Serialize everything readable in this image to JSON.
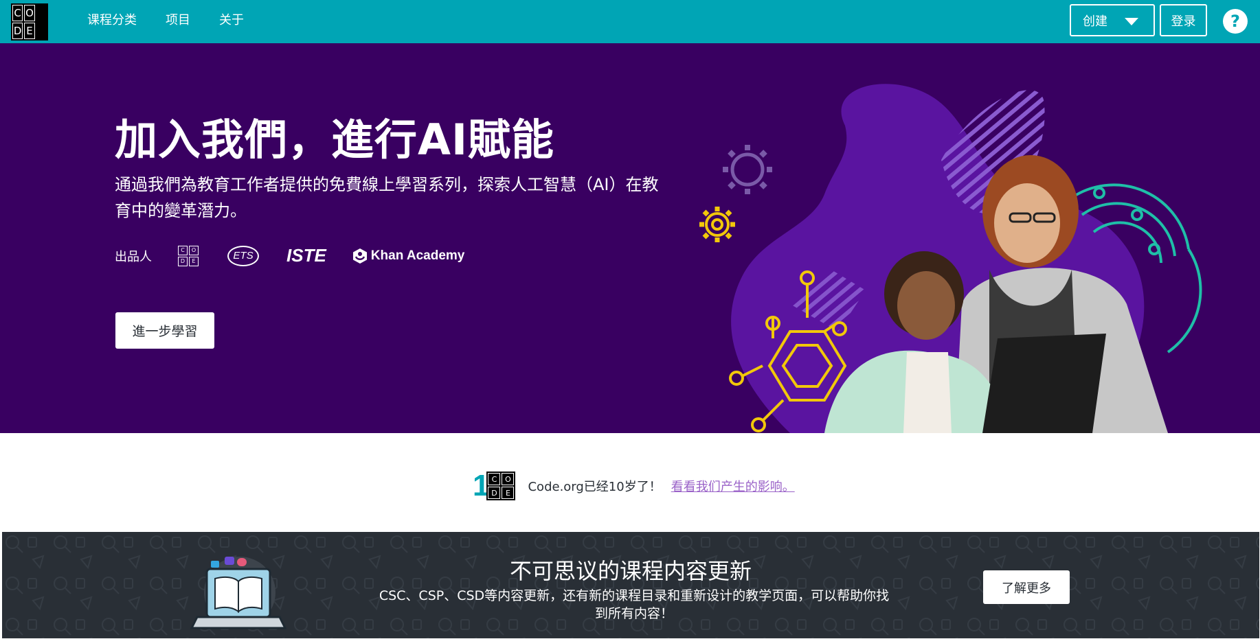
{
  "header": {
    "logo_letters": [
      "C",
      "O",
      "D",
      "E"
    ],
    "nav": [
      {
        "label": "课程分类"
      },
      {
        "label": "项目"
      },
      {
        "label": "关于"
      }
    ],
    "create_label": "创建",
    "login_label": "登录",
    "help_label": "?"
  },
  "hero": {
    "title": "加入我們，進行AI賦能",
    "subtitle": "通過我們為教育工作者提供的免費線上學習系列，探索人工智慧（AI）在教育中的變革潛力。",
    "presented_by": "出品人",
    "partners": {
      "code_letters": [
        "C",
        "O",
        "D",
        "E"
      ],
      "ets": "ETS",
      "iste": "ISTE",
      "khan": "Khan Academy"
    },
    "learn_button": "進一步學習"
  },
  "anniversary": {
    "logo_digit": "1",
    "logo_letters": [
      "C",
      "O",
      "D",
      "E"
    ],
    "text": "Code.org已经10岁了！",
    "link": "看看我们产生的影响。"
  },
  "update_banner": {
    "title": "不可思议的课程内容更新",
    "description": "CSC、CSP、CSD等内容更新，还有新的课程目录和重新设计的教学页面，可以帮助你找到所有内容！",
    "button": "了解更多"
  },
  "colors": {
    "header_bg": "#00a5b5",
    "hero_bg": "#390061",
    "blob": "#5a14a0",
    "banner_bg": "#292f36",
    "link": "#9a62c8",
    "gear_yellow": "#f2c80a",
    "circuit_teal": "#1fbfa8"
  }
}
